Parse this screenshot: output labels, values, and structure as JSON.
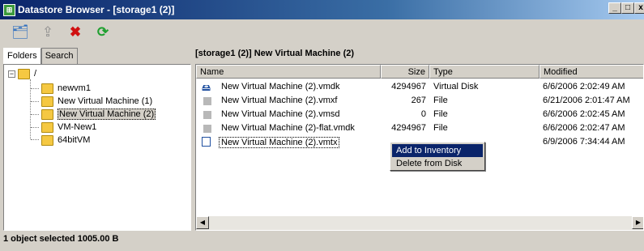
{
  "window": {
    "title": "Datastore Browser - [storage1 (2)]",
    "min_label": "_",
    "max_label": "□",
    "close_label": "x"
  },
  "toolbar": {
    "buttons": [
      {
        "icon": "browse-datastore-icon",
        "glyph": "🗂"
      },
      {
        "icon": "upload-icon",
        "glyph": "⇪"
      },
      {
        "icon": "delete-icon",
        "glyph": "✖"
      },
      {
        "icon": "refresh-icon",
        "glyph": "⟳"
      }
    ]
  },
  "left": {
    "tabs": [
      "Folders",
      "Search"
    ],
    "root": "/",
    "root_toggle": "−",
    "folders": [
      "newvm1",
      "New Virtual Machine (1)",
      "New Virtual Machine (2)",
      "VM-New1",
      "64bitVM"
    ],
    "selected_folder": "New Virtual Machine (2)"
  },
  "right": {
    "header": "[storage1 (2)] New Virtual Machine (2)",
    "columns": [
      "Name",
      "Size",
      "Type",
      "Modified"
    ],
    "rows": [
      {
        "name": "New Virtual Machine (2).vmdk",
        "size": "4294967",
        "type": "Virtual Disk",
        "modified": "6/6/2006 2:02:49 AM",
        "icon": "virtual-disk-icon"
      },
      {
        "name": "New Virtual Machine (2).vmxf",
        "size": "267",
        "type": "File",
        "modified": "6/21/2006 2:01:47 AM",
        "icon": "file-icon"
      },
      {
        "name": "New Virtual Machine (2).vmsd",
        "size": "0",
        "type": "File",
        "modified": "6/6/2006 2:02:45 AM",
        "icon": "file-icon"
      },
      {
        "name": "New Virtual Machine (2)-flat.vmdk",
        "size": "4294967",
        "type": "File",
        "modified": "6/6/2006 2:02:47 AM",
        "icon": "file-icon"
      },
      {
        "name": "New Virtual Machine (2).vmtx",
        "size": "",
        "type": "",
        "modified": "6/9/2006 7:34:44 AM",
        "icon": "template-icon"
      }
    ],
    "selected_row": 4
  },
  "context_menu": {
    "items": [
      "Add to Inventory",
      "Delete from Disk"
    ],
    "highlighted": 0
  },
  "status": {
    "text": "1 object selected 1005.00 B"
  }
}
